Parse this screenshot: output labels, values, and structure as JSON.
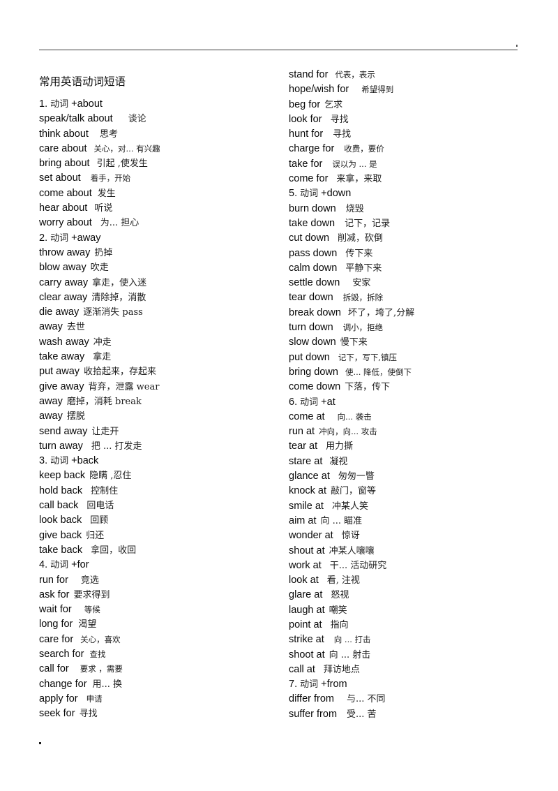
{
  "document": {
    "title": "常用英语动词短语",
    "header_rule": true,
    "footer_mark": "."
  },
  "columns": {
    "left": [
      {
        "type": "heading",
        "num": "1.",
        "zh": "动词",
        "en": "+about"
      },
      {
        "type": "entry",
        "en": "speak/talk about",
        "zh": "谈论",
        "gap": 22
      },
      {
        "type": "entry",
        "en": "think about",
        "zh": "思考",
        "gap": 16
      },
      {
        "type": "entry",
        "en": "care about",
        "zh": "关心，对... 有兴趣",
        "gap": 10,
        "small": true
      },
      {
        "type": "entry",
        "en": "bring about",
        "zh": "引起 ,使发生",
        "gap": 10
      },
      {
        "type": "entry",
        "en": "set about",
        "zh": "着手，开始",
        "gap": 14,
        "small": true
      },
      {
        "type": "entry",
        "en": "come about",
        "zh": "发生",
        "gap": 8
      },
      {
        "type": "entry",
        "en": "hear about",
        "zh": "听说",
        "gap": 10
      },
      {
        "type": "entry",
        "en": "worry about",
        "zh": "为... 担心",
        "gap": 12
      },
      {
        "type": "heading",
        "num": "2.",
        "zh": "动词",
        "en": "+away"
      },
      {
        "type": "entry",
        "en": "throw away",
        "zh": "扔掉",
        "gap": 6
      },
      {
        "type": "entry",
        "en": "blow away",
        "zh": "吹走",
        "gap": 6
      },
      {
        "type": "entry",
        "en": "carry away",
        "zh": "拿走，使入迷",
        "gap": 6
      },
      {
        "type": "entry",
        "en": "clear away",
        "zh": "清除掉，消散",
        "gap": 6
      },
      {
        "type": "entry",
        "en": "die away",
        "zh": "逐渐消失 pass",
        "gap": 6
      },
      {
        "type": "entry",
        "en": "away",
        "zh": "去世",
        "gap": 6
      },
      {
        "type": "entry",
        "en": "wash away",
        "zh": "冲走",
        "gap": 6
      },
      {
        "type": "entry",
        "en": "take away",
        "zh": "拿走",
        "gap": 12
      },
      {
        "type": "entry",
        "en": "put away",
        "zh": "收拾起来，存起来",
        "gap": 6
      },
      {
        "type": "entry",
        "en": "give away",
        "zh": "背弃，泄露 wear",
        "gap": 6
      },
      {
        "type": "entry",
        "en": "away",
        "zh": "磨掉，消耗 break",
        "gap": 6
      },
      {
        "type": "entry",
        "en": "away",
        "zh": "摆脱",
        "gap": 6
      },
      {
        "type": "entry",
        "en": "send away",
        "zh": "让走开",
        "gap": 6
      },
      {
        "type": "entry",
        "en": "turn away",
        "zh": "把 ... 打发走",
        "gap": 12
      },
      {
        "type": "heading",
        "num": "3.",
        "zh": "动词",
        "en": "+back"
      },
      {
        "type": "entry",
        "en": "keep back",
        "zh": "隐瞒 ,忍住",
        "gap": 6
      },
      {
        "type": "entry",
        "en": "hold back",
        "zh": "控制住",
        "gap": 12
      },
      {
        "type": "entry",
        "en": "call back",
        "zh": "回电话",
        "gap": 12
      },
      {
        "type": "entry",
        "en": "look back",
        "zh": "回顾",
        "gap": 12
      },
      {
        "type": "entry",
        "en": "give back",
        "zh": "归还",
        "gap": 6
      },
      {
        "type": "entry",
        "en": "take back",
        "zh": "拿回，收回",
        "gap": 12
      },
      {
        "type": "heading",
        "num": "4.",
        "zh": "动词",
        "en": "+for"
      },
      {
        "type": "entry",
        "en": "run for",
        "zh": "竞选",
        "gap": 18
      },
      {
        "type": "entry",
        "en": "ask for",
        "zh": "要求得到",
        "gap": 6
      },
      {
        "type": "entry",
        "en": "wait for",
        "zh": "等候",
        "gap": 18,
        "small": true
      },
      {
        "type": "entry",
        "en": "long for",
        "zh": "渴望",
        "gap": 8
      },
      {
        "type": "entry",
        "en": "care for",
        "zh": "关心，喜欢",
        "gap": 10,
        "small": true
      },
      {
        "type": "entry",
        "en": "search for",
        "zh": "查找",
        "gap": 8,
        "small": true
      },
      {
        "type": "entry",
        "en": "call for",
        "zh": "要求 ，需要",
        "gap": 16,
        "small": true
      },
      {
        "type": "entry",
        "en": "change for",
        "zh": "用... 换",
        "gap": 8
      },
      {
        "type": "entry",
        "en": "apply for",
        "zh": "申请",
        "gap": 12,
        "small": true
      },
      {
        "type": "entry",
        "en": "seek for",
        "zh": "寻找",
        "gap": 6
      }
    ],
    "right": [
      {
        "type": "entry",
        "en": "stand for",
        "zh": "代表，表示",
        "gap": 10,
        "small": true
      },
      {
        "type": "entry",
        "en": "hope/wish for",
        "zh": "希望得到",
        "gap": 18,
        "small": true
      },
      {
        "type": "entry",
        "en": "beg for",
        "zh": "乞求",
        "gap": 6
      },
      {
        "type": "entry",
        "en": "look for",
        "zh": "寻找",
        "gap": 12
      },
      {
        "type": "entry",
        "en": "hunt for",
        "zh": "寻找",
        "gap": 14
      },
      {
        "type": "entry",
        "en": "charge for",
        "zh": "收费，要价",
        "gap": 14,
        "small": true
      },
      {
        "type": "entry",
        "en": "take for",
        "zh": "误以为 ... 是",
        "gap": 14,
        "small": true
      },
      {
        "type": "entry",
        "en": "come for",
        "zh": "来拿，来取",
        "gap": 12
      },
      {
        "type": "heading",
        "num": "5.",
        "zh": "动词",
        "en": "+down"
      },
      {
        "type": "entry",
        "en": "burn down",
        "zh": "烧毁",
        "gap": 14
      },
      {
        "type": "entry",
        "en": "take down",
        "zh": "记下，记录",
        "gap": 14
      },
      {
        "type": "entry",
        "en": "cut down",
        "zh": "削减，砍倒",
        "gap": 12
      },
      {
        "type": "entry",
        "en": "pass down",
        "zh": "传下来",
        "gap": 12
      },
      {
        "type": "entry",
        "en": "calm down",
        "zh": "平静下来",
        "gap": 12
      },
      {
        "type": "entry",
        "en": "settle down",
        "zh": "安家",
        "gap": 18
      },
      {
        "type": "entry",
        "en": "tear down",
        "zh": "拆毁，拆除",
        "gap": 14,
        "small": true
      },
      {
        "type": "entry",
        "en": "break down",
        "zh": "坏了，垮了,分解",
        "gap": 10
      },
      {
        "type": "entry",
        "en": "turn down",
        "zh": "调小，拒绝",
        "gap": 14,
        "small": true
      },
      {
        "type": "entry",
        "en": "slow down",
        "zh": "慢下来",
        "gap": 6
      },
      {
        "type": "entry",
        "en": "put down",
        "zh": "记下，写下,镇压",
        "gap": 12,
        "small": true
      },
      {
        "type": "entry",
        "en": "bring down",
        "zh": "使... 降低，使倒下",
        "gap": 10,
        "small": true
      },
      {
        "type": "entry",
        "en": "come down",
        "zh": "下落，传下",
        "gap": 6
      },
      {
        "type": "heading",
        "num": "6.",
        "zh": "动词",
        "en": "+at"
      },
      {
        "type": "entry",
        "en": "come at",
        "zh": "向... 袭击",
        "gap": 18,
        "small": true
      },
      {
        "type": "entry",
        "en": "run at",
        "zh": "冲向，向... 攻击",
        "gap": 6,
        "small": true
      },
      {
        "type": "entry",
        "en": "tear at",
        "zh": "用力撕",
        "gap": 12
      },
      {
        "type": "entry",
        "en": "stare at",
        "zh": "凝视",
        "gap": 10
      },
      {
        "type": "entry",
        "en": "glance at",
        "zh": "匆匆一瞥",
        "gap": 12
      },
      {
        "type": "entry",
        "en": "knock at",
        "zh": "敲门，窗等",
        "gap": 6
      },
      {
        "type": "entry",
        "en": "smile at",
        "zh": "冲某人笑",
        "gap": 12
      },
      {
        "type": "entry",
        "en": "aim at",
        "zh": "向 ... 瞄准",
        "gap": 6
      },
      {
        "type": "entry",
        "en": "wonder at",
        "zh": "惊讶",
        "gap": 12
      },
      {
        "type": "entry",
        "en": "shout at",
        "zh": "冲某人嚷嚷",
        "gap": 6
      },
      {
        "type": "entry",
        "en": "work at",
        "zh": "干... 活动研究",
        "gap": 12
      },
      {
        "type": "entry",
        "en": "look at",
        "zh": "看, 注视",
        "gap": 12
      },
      {
        "type": "entry",
        "en": "glare at",
        "zh": "怒视",
        "gap": 12
      },
      {
        "type": "entry",
        "en": "laugh at",
        "zh": "嘲笑",
        "gap": 6
      },
      {
        "type": "entry",
        "en": "point at",
        "zh": "指向",
        "gap": 12
      },
      {
        "type": "entry",
        "en": "strike at",
        "zh": "向 ... 打击",
        "gap": 14,
        "small": true
      },
      {
        "type": "entry",
        "en": "shoot at",
        "zh": "向 ... 射击",
        "gap": 6
      },
      {
        "type": "entry",
        "en": "call at",
        "zh": "拜访地点",
        "gap": 12
      },
      {
        "type": "heading",
        "num": "7.",
        "zh": "动词",
        "en": "+from"
      },
      {
        "type": "entry",
        "en": "differ from",
        "zh": "与... 不同",
        "gap": 18
      },
      {
        "type": "entry",
        "en": "suffer from",
        "zh": "受... 苦",
        "gap": 14
      }
    ]
  }
}
